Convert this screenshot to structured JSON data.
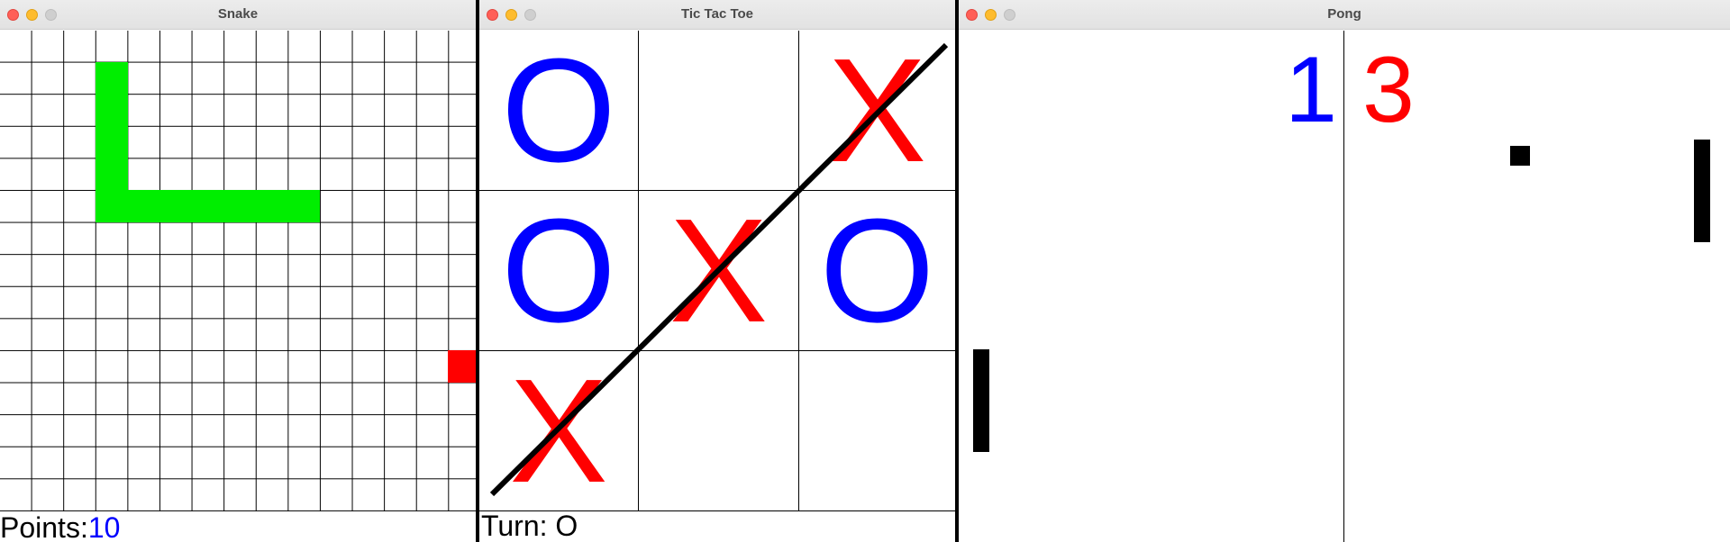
{
  "snake": {
    "title": "Snake",
    "points_label": "Points:",
    "points_value": "10",
    "colors": {
      "snake": "#00ee00",
      "food": "#ff0000",
      "points_value": "#0000ff"
    }
  },
  "tictactoe": {
    "title": "Tic Tac Toe",
    "turn_label": "Turn:",
    "turn_value": "O",
    "board": [
      "O",
      "",
      "X",
      "O",
      "X",
      "O",
      "X",
      "",
      ""
    ],
    "winning_line": "anti-diagonal",
    "colors": {
      "x": "#ff0000",
      "o": "#0000ff"
    }
  },
  "pong": {
    "title": "Pong",
    "score_left": "1",
    "score_right": "3",
    "colors": {
      "score_left": "#0000ff",
      "score_right": "#ff0000"
    }
  }
}
